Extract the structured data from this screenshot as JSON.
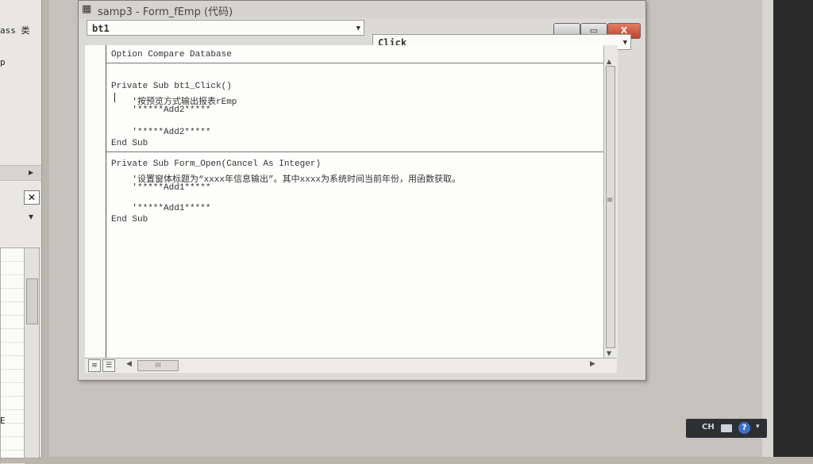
{
  "left_panel": {
    "label_top": "ass 类",
    "label_p": "p",
    "close_glyph": "✕",
    "arrow_right": "▸",
    "arrow_down": "▾",
    "char_bottom": "E"
  },
  "window": {
    "title": "samp3 - Form_fEmp (代码)",
    "icon": "vba-code-icon",
    "min_glyph": "▁",
    "max_glyph": "▭",
    "close_glyph": "X"
  },
  "object_combo": {
    "value": "bt1"
  },
  "procedure_combo": {
    "value": "Click"
  },
  "code_lines": [
    "Option Compare Database",
    "Private Sub bt1_Click()",
    "    '按预览方式输出报表rEmp",
    "    '*****Add2*****",
    "    '*****Add2*****",
    "End Sub",
    "Private Sub Form_Open(Cancel As Integer)",
    "    '设置窗体标题为“xxxx年信息输出”。其中xxxx为系统时间当前年份，用函数获取。",
    "    '*****Add1*****",
    "    '*****Add1*****",
    "End Sub"
  ],
  "scrollbar": {
    "grip": "≡",
    "hgrip": "III"
  },
  "tray": {
    "ime": "CH",
    "help": "?",
    "more": "▾"
  },
  "colors": {
    "close_button": "#c2412a",
    "tray": "#2e2f33",
    "help_icon": "#3a6fd0"
  }
}
